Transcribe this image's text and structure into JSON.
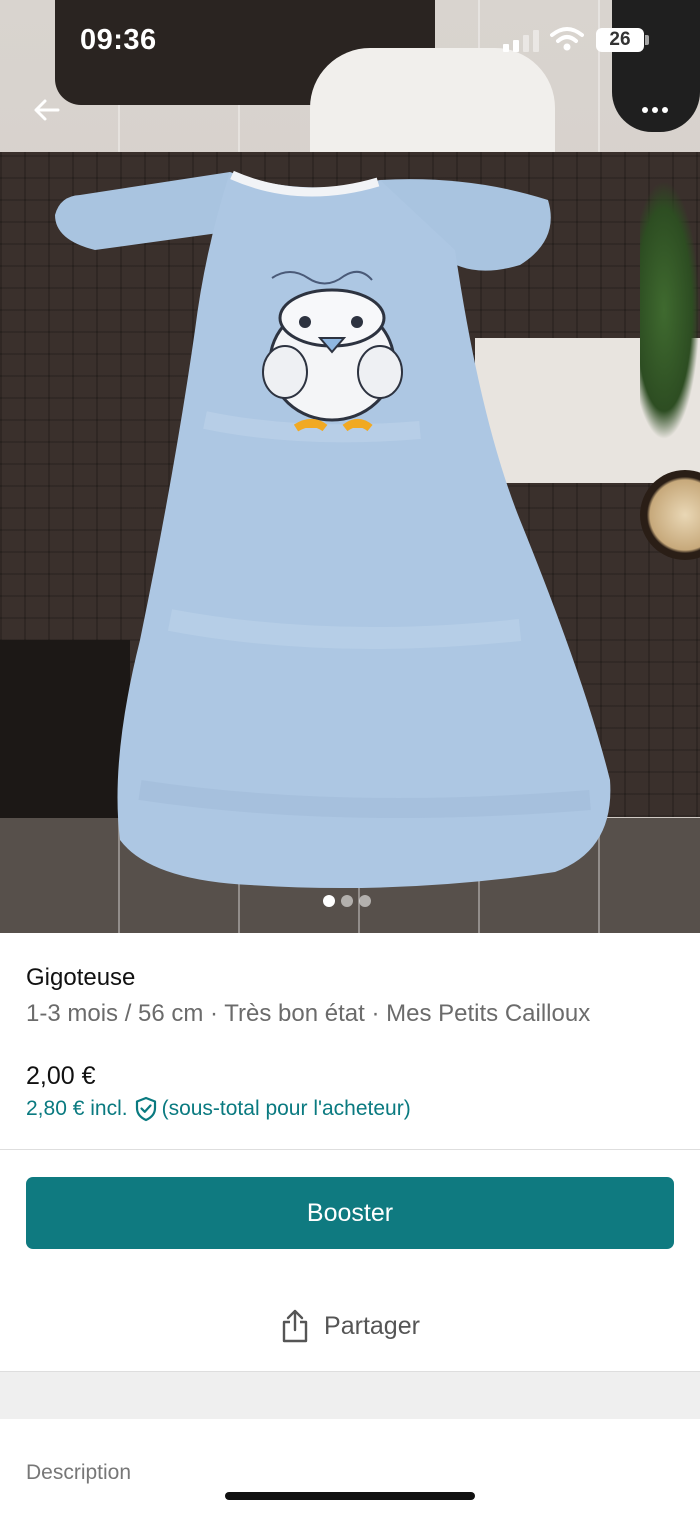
{
  "status_bar": {
    "time": "09:36",
    "battery": "26"
  },
  "photo": {
    "description_icon": "photo",
    "pager": {
      "count": 3,
      "active_index": 0
    }
  },
  "item": {
    "title": "Gigoteuse",
    "subtitle": "1-3 mois / 56 cm · Très bon état · Mes Petits Cailloux",
    "price": "2,00 €",
    "price_incl": "2,80 € incl.",
    "price_note": "(sous-total pour l'acheteur)"
  },
  "actions": {
    "booster_label": "Booster",
    "share_label": "Partager"
  },
  "section": {
    "description_label": "Description"
  },
  "colors": {
    "accent": "#0f7a80",
    "accent_text": "#0a7a80"
  }
}
